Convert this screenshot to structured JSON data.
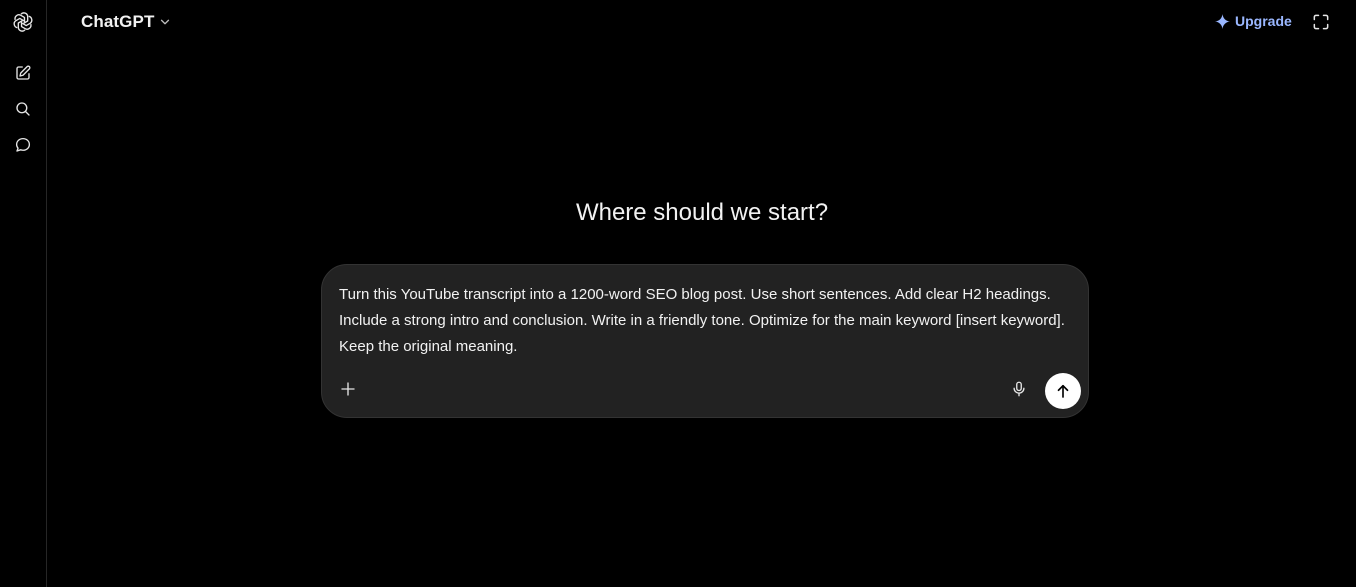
{
  "app": {
    "model_name": "ChatGPT",
    "upgrade_label": "Upgrade"
  },
  "sidebar": {
    "items": [
      {
        "icon": "openai-logo-icon"
      },
      {
        "icon": "new-chat-icon"
      },
      {
        "icon": "search-icon"
      },
      {
        "icon": "chat-bubble-icon"
      }
    ]
  },
  "main": {
    "headline": "Where should we start?",
    "composer": {
      "prompt_text": "Turn this YouTube transcript into a 1200-word SEO blog post. Use short sentences. Add clear H2 headings. Include a strong intro and conclusion. Write in a friendly tone. Optimize for the main keyword [insert keyword]. Keep the original meaning."
    }
  },
  "colors": {
    "background": "#000000",
    "composer_bg": "#222222",
    "upgrade_accent": "#9ab7ff",
    "send_button": "#ffffff"
  }
}
